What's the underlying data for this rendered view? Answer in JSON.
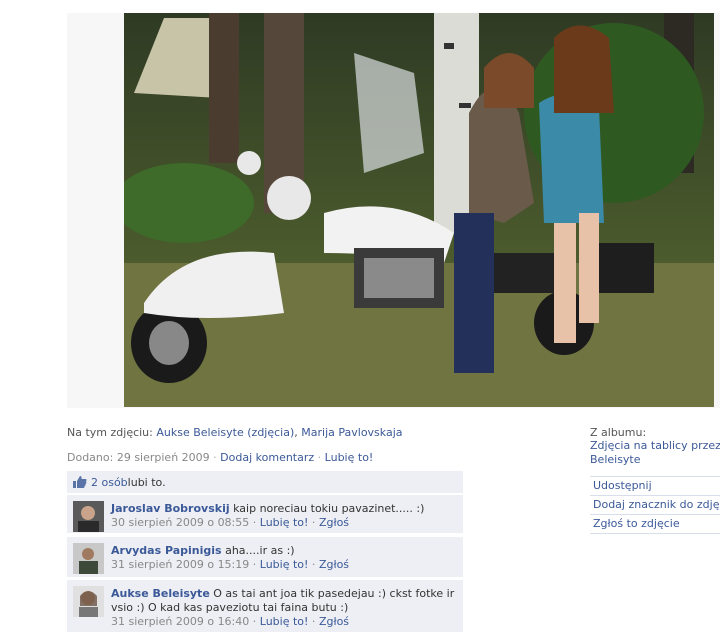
{
  "tag_line": {
    "prefix": "Na tym zdjęciu: ",
    "person1": "Aukse Beleisyte",
    "person1_photos": "(zdjęcia)",
    "comma": ", ",
    "person2": "Marija Pavlovskaja"
  },
  "meta": {
    "added": "Dodano: 29 sierpień 2009",
    "sep": " · ",
    "add_comment": "Dodaj komentarz",
    "like": "Lubię to!"
  },
  "likes": {
    "count_link": "2 osób",
    "suffix": " lubi to."
  },
  "comments": [
    {
      "author": "Jaroslav Bobrovskij",
      "text": " kaip noreciau tokiu pavazinet..... :)",
      "date": "30 sierpień 2009 o 08:55",
      "like": "Lubię to!",
      "report": "Zgłoś"
    },
    {
      "author": "Arvydas Papinigis",
      "text": " aha....ir as :)",
      "date": "31 sierpień 2009 o 15:19",
      "like": "Lubię to!",
      "report": "Zgłoś"
    },
    {
      "author": "Aukse Beleisyte",
      "text": " O as tai ant joa tik pasedejau :) ckst fotke ir vsio :) O kad kas paveziotu tai faina butu :)",
      "date": "31 sierpień 2009 o 16:40",
      "like": "Lubię to!",
      "report": "Zgłoś"
    }
  ],
  "sidebar": {
    "album_label": "Z albumu:",
    "album_link_line1": "Zdjęcia na tablicy przez Auk",
    "album_link_line2": "Beleisyte",
    "actions": [
      "Udostępnij",
      "Dodaj znacznik do zdjęcia",
      "Zgłoś to zdjęcie"
    ]
  },
  "colors": {
    "link": "#3b5998",
    "comment_bg": "#edeff4"
  },
  "icons": {
    "like": "thumbs-up-icon"
  }
}
